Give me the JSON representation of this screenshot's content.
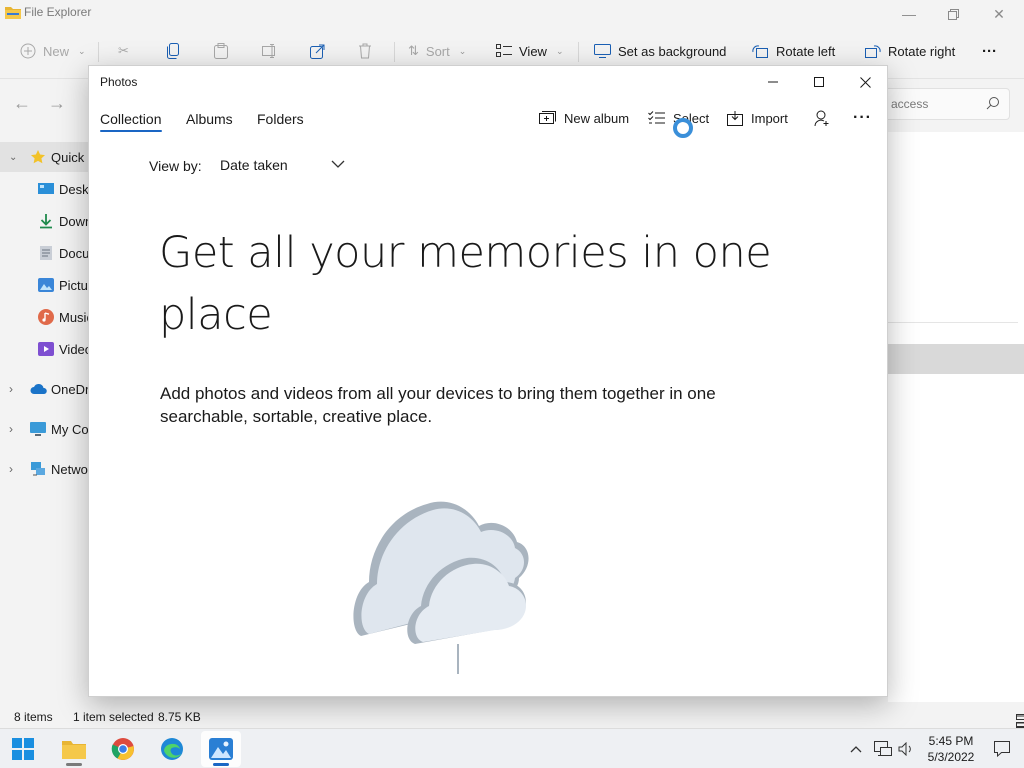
{
  "file_explorer": {
    "title": "File Explorer",
    "commands": {
      "new": "New",
      "sort": "Sort",
      "view": "View",
      "set_background": "Set as background",
      "rotate_left": "Rotate left",
      "rotate_right": "Rotate right",
      "more": "···"
    },
    "search_placeholder": "access",
    "sidebar": [
      {
        "label": "Quick a",
        "icon": "star-icon"
      },
      {
        "label": "Deskt",
        "icon": "desktop-icon"
      },
      {
        "label": "Down",
        "icon": "download-icon"
      },
      {
        "label": "Docu",
        "icon": "document-icon"
      },
      {
        "label": "Pictur",
        "icon": "pictures-icon"
      },
      {
        "label": "Music",
        "icon": "music-icon"
      },
      {
        "label": "Video",
        "icon": "videos-icon"
      },
      {
        "label": "OneDri",
        "icon": "onedrive-icon"
      },
      {
        "label": "My Co",
        "icon": "computer-icon"
      },
      {
        "label": "Netwo",
        "icon": "network-icon"
      }
    ],
    "status": {
      "items": "8 items",
      "selected": "1 item selected",
      "size": "8.75 KB"
    }
  },
  "photos": {
    "title": "Photos",
    "tabs": [
      "Collection",
      "Albums",
      "Folders"
    ],
    "active_tab": "Collection",
    "actions": {
      "new_album": "New album",
      "select": "Select",
      "import": "Import",
      "more": "···"
    },
    "view_by_label": "View by:",
    "view_by_value": "Date taken",
    "hero_title": "Get all your memories in one place",
    "hero_subtitle": "Add photos and videos from all your devices to bring them together in one searchable, sortable, creative place.",
    "accent_color": "#1a66c4"
  },
  "taskbar": {
    "apps": [
      "start-icon",
      "file-explorer-icon",
      "chrome-icon",
      "edge-icon",
      "photos-icon"
    ],
    "time": "5:45 PM",
    "date": "5/3/2022"
  }
}
